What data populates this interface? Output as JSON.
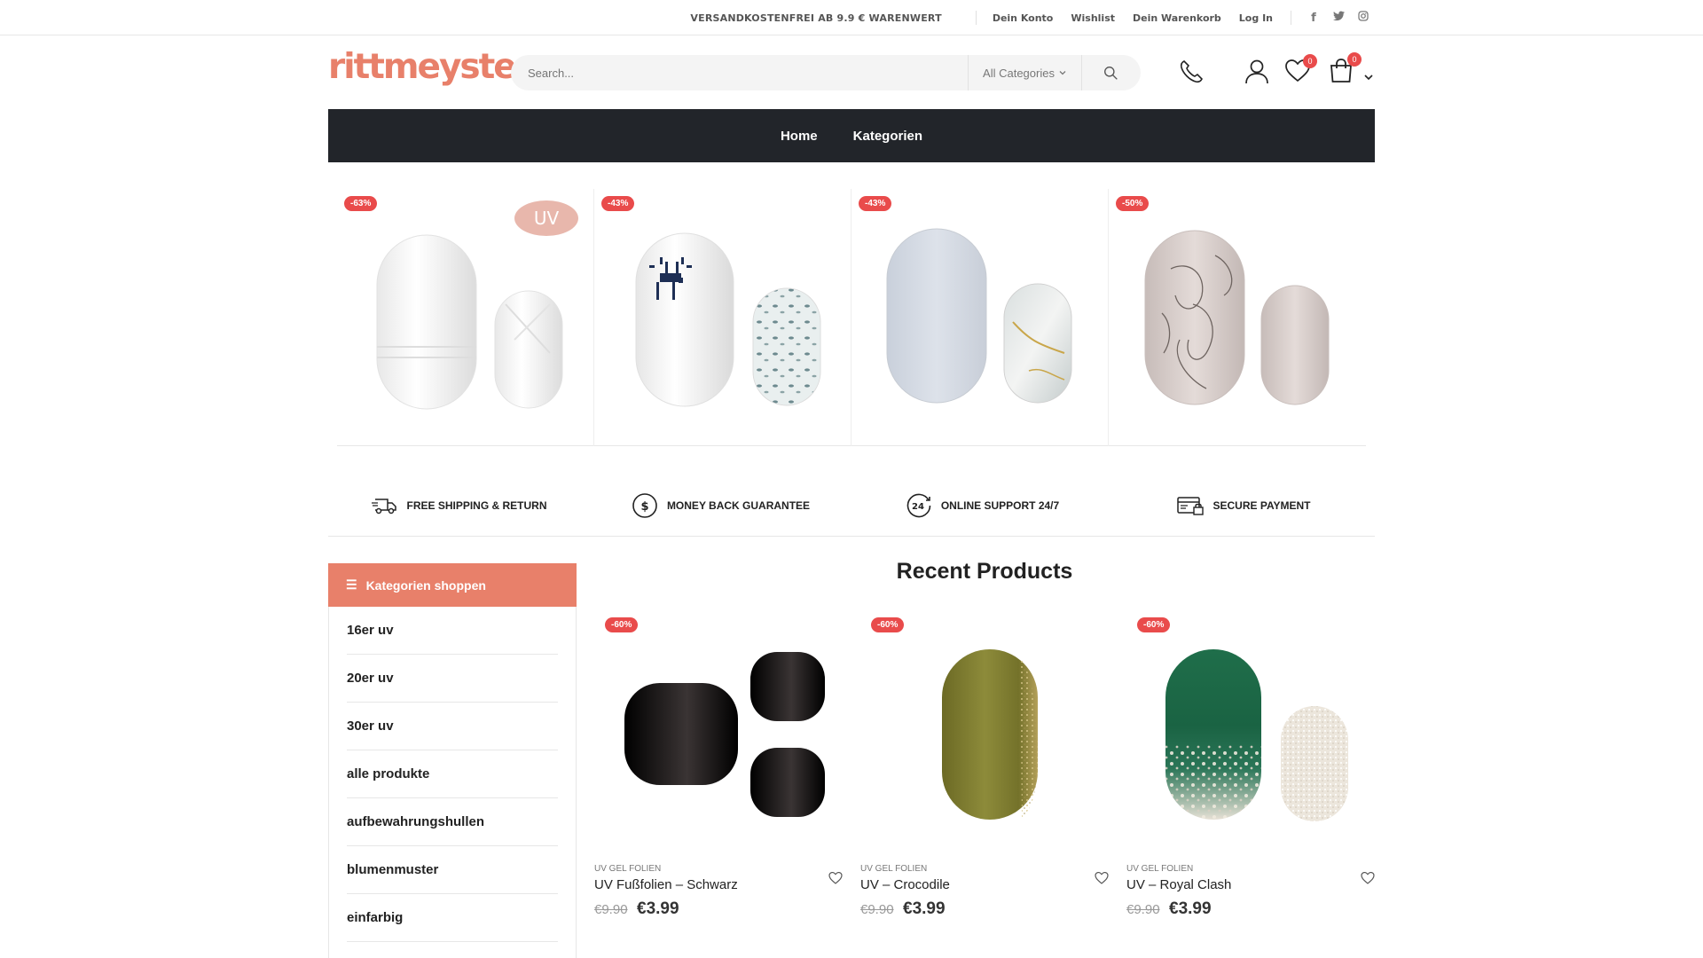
{
  "topbar": {
    "promo": "VERSANDKOSTENFREI AB 9.9 € WARENWERT",
    "links": [
      "Dein Konto",
      "Wishlist",
      "Dein Warenkorb",
      "Log In"
    ],
    "social_icons": [
      "facebook-icon",
      "twitter-icon",
      "instagram-icon"
    ]
  },
  "header": {
    "logo": "rittmeyster",
    "search_placeholder": "Search...",
    "category_select": "All Categories",
    "wishlist_count": "0",
    "cart_count": "0"
  },
  "nav": {
    "items": [
      "Home",
      "Kategorien"
    ]
  },
  "top_products": [
    {
      "discount": "-63%"
    },
    {
      "discount": "-43%"
    },
    {
      "discount": "-43%"
    },
    {
      "discount": "-50%"
    }
  ],
  "features": [
    {
      "label": "FREE SHIPPING & RETURN",
      "icon": "truck-icon"
    },
    {
      "label": "MONEY BACK GUARANTEE",
      "icon": "dollar-icon"
    },
    {
      "label": "ONLINE SUPPORT 24/7",
      "icon": "support-24-icon"
    },
    {
      "label": "SECURE PAYMENT",
      "icon": "secure-payment-icon"
    }
  ],
  "sidebar": {
    "title": "Kategorien shoppen",
    "items": [
      "16er uv",
      "20er uv",
      "30er uv",
      "alle produkte",
      "aufbewahrungshullen",
      "blumenmuster",
      "einfarbig"
    ]
  },
  "recent": {
    "title": "Recent Products",
    "products": [
      {
        "discount": "-60%",
        "category": "UV GEL FOLIEN",
        "name": "UV Fußfolien – Schwarz",
        "old_price": "€9.90",
        "price": "€3.99"
      },
      {
        "discount": "-60%",
        "category": "UV GEL FOLIEN",
        "name": "UV – Crocodile",
        "old_price": "€9.90",
        "price": "€3.99"
      },
      {
        "discount": "-60%",
        "category": "UV GEL FOLIEN",
        "name": "UV – Royal Clash",
        "old_price": "€9.90",
        "price": "€3.99"
      }
    ]
  },
  "colors": {
    "brand": "#e8806a",
    "nav_bg": "#22252a",
    "badge": "#e94b4b"
  }
}
